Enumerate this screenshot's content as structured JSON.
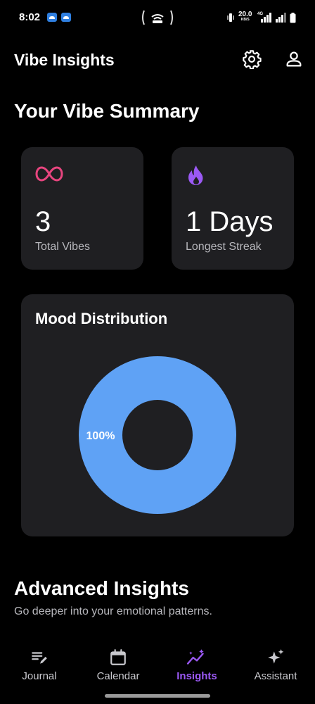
{
  "status_bar": {
    "time": "8:02",
    "speed": "20.0",
    "speed_unit": "KB/S",
    "network": "4G"
  },
  "app": {
    "title": "Vibe Insights",
    "icons": [
      "gear-icon",
      "profile-icon"
    ]
  },
  "summary": {
    "title": "Your Vibe Summary",
    "cards": [
      {
        "value": "3",
        "label": "Total Vibes",
        "icon": "infinity-icon",
        "icon_color": "#e8457f"
      },
      {
        "value": "1 Days",
        "label": "Longest Streak",
        "icon": "flame-icon",
        "icon_color": "#9b59f5"
      }
    ]
  },
  "mood": {
    "title": "Mood Distribution",
    "chart_data": {
      "type": "pie",
      "categories": [
        ""
      ],
      "values": [
        100
      ],
      "data_labels": [
        "100%"
      ],
      "colors": [
        "#5fa2f5"
      ],
      "donut": true
    }
  },
  "advanced": {
    "title": "Advanced Insights",
    "subtitle": "Go deeper into your emotional patterns."
  },
  "nav": {
    "items": [
      {
        "label": "Journal",
        "icon": "journal-icon",
        "active": false
      },
      {
        "label": "Calendar",
        "icon": "calendar-icon",
        "active": false
      },
      {
        "label": "Insights",
        "icon": "insights-icon",
        "active": true
      },
      {
        "label": "Assistant",
        "icon": "sparkle-icon",
        "active": false
      }
    ],
    "active_color": "#9b59f5"
  }
}
